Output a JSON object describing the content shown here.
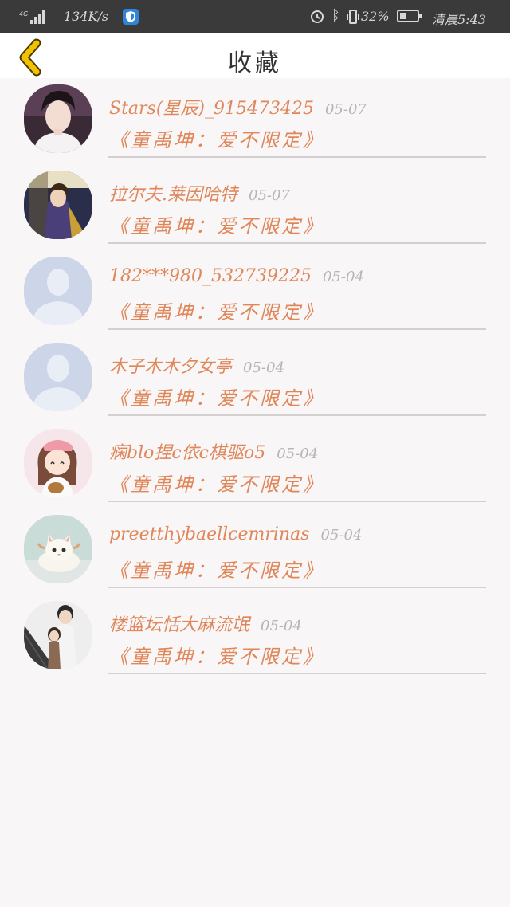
{
  "status_bar": {
    "network": "4G",
    "speed": "134K/s",
    "battery_pct": "32%",
    "battery_level": 0.32,
    "time": "清晨5:43"
  },
  "header": {
    "title": "收藏",
    "back_icon": "chevron-left-icon",
    "back_color": "#f2c200"
  },
  "items": [
    {
      "name": "Stars(星辰)_915473425",
      "date": "05-07",
      "subtitle": "《童禹坤：爱不限定》",
      "avatar": "photo-young-man"
    },
    {
      "name": "拉尔夫.莱因哈特",
      "date": "05-07",
      "subtitle": "《童禹坤：爱不限定》",
      "avatar": "anime-character"
    },
    {
      "name": "182***980_532739225",
      "date": "05-04",
      "subtitle": "《童禹坤：爱不限定》",
      "avatar": "default-user"
    },
    {
      "name": "木子木木夕女亭",
      "date": "05-04",
      "subtitle": "《童禹坤：爱不限定》",
      "avatar": "default-user"
    },
    {
      "name": "痫blo捏c依c棋驱o5",
      "date": "05-04",
      "subtitle": "《童禹坤：爱不限定》",
      "avatar": "cartoon-girl"
    },
    {
      "name": "preetthybaellcemrinas",
      "date": "05-04",
      "subtitle": "《童禹坤：爱不限定》",
      "avatar": "white-kitten"
    },
    {
      "name": "楼篮坛恬大麻流氓",
      "date": "05-04",
      "subtitle": "《童禹坤：爱不限定》",
      "avatar": "couple-photo"
    }
  ]
}
